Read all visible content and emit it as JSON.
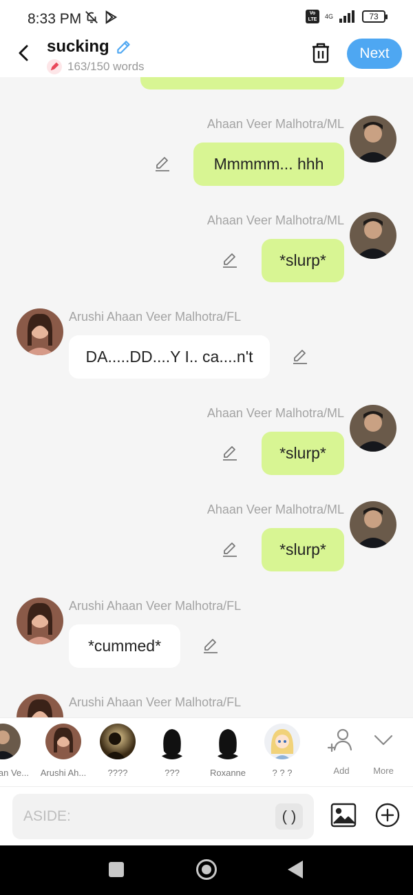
{
  "status": {
    "time": "8:33 PM",
    "net": "4G",
    "battery": "73",
    "volte": "Vo LTE"
  },
  "header": {
    "title": "sucking",
    "word_count": "163/150 words",
    "next_label": "Next"
  },
  "messages": [
    {
      "type": "mine",
      "name": "Ahaan Veer Malhotra/ML",
      "text": "Mmmmm... hhh"
    },
    {
      "type": "mine",
      "name": "Ahaan Veer Malhotra/ML",
      "text": "*slurp*"
    },
    {
      "type": "theirs",
      "name": "Arushi Ahaan Veer Malhotra/FL",
      "text": "DA.....DD....Y I.. ca....n't"
    },
    {
      "type": "mine",
      "name": "Ahaan Veer Malhotra/ML",
      "text": "*slurp*"
    },
    {
      "type": "mine",
      "name": "Ahaan Veer Malhotra/ML",
      "text": "*slurp*"
    },
    {
      "type": "theirs",
      "name": "Arushi Ahaan Veer Malhotra/FL",
      "text": "*cummed*"
    },
    {
      "type": "theirs",
      "name": "Arushi Ahaan Veer Malhotra/FL",
      "text": ""
    }
  ],
  "characters": [
    {
      "label": "Ahaan Ve..."
    },
    {
      "label": "Arushi Ah..."
    },
    {
      "label": "????"
    },
    {
      "label": "???"
    },
    {
      "label": "Roxanne"
    },
    {
      "label": "? ? ?"
    }
  ],
  "actions": {
    "add_label": "Add",
    "more_label": "More"
  },
  "input": {
    "placeholder": "ASIDE:",
    "paren_label": "( )"
  },
  "colors": {
    "accent": "#4ea7f2",
    "mine_bubble": "#d8f593",
    "theirs_bubble": "#ffffff"
  }
}
